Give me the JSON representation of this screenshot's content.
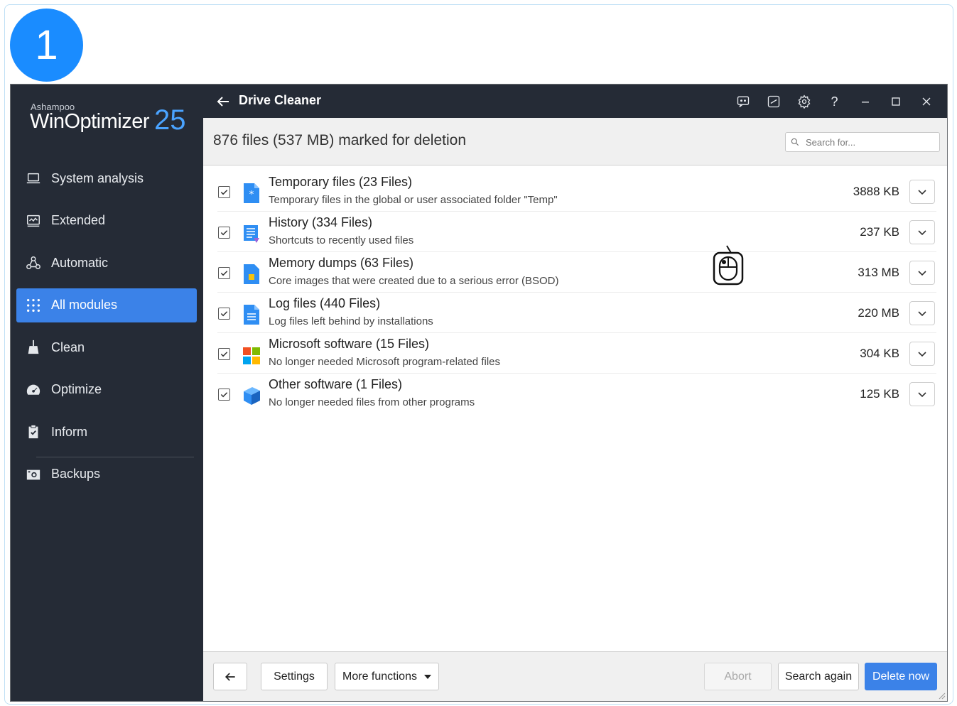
{
  "step_badge": "1",
  "brand": {
    "vendor": "Ashampoo",
    "product": "WinOptimizer",
    "version": "25"
  },
  "sidebar": {
    "items": [
      {
        "label": "System analysis",
        "icon": "laptop-icon",
        "active": false
      },
      {
        "label": "Extended",
        "icon": "monitor-chart-icon",
        "active": false
      },
      {
        "label": "Automatic",
        "icon": "webhook-icon",
        "active": false
      },
      {
        "label": "All modules",
        "icon": "grid-dots-icon",
        "active": true
      },
      {
        "label": "Clean",
        "icon": "broom-icon",
        "active": false
      },
      {
        "label": "Optimize",
        "icon": "speedometer-icon",
        "active": false
      },
      {
        "label": "Inform",
        "icon": "clipboard-check-icon",
        "active": false
      },
      {
        "label": "Backups",
        "icon": "camera-backup-icon",
        "active": false
      }
    ]
  },
  "titlebar": {
    "title": "Drive Cleaner",
    "icons": [
      "chat-icon",
      "note-icon",
      "gear-icon",
      "help-icon",
      "minimize-icon",
      "maximize-icon",
      "close-icon"
    ],
    "help_glyph": "?"
  },
  "summary": {
    "text": "876 files (537 MB) marked for deletion",
    "search_placeholder": "Search for..."
  },
  "items": [
    {
      "title": "Temporary files (23 Files)",
      "desc": "Temporary files in the global or user associated folder \"Temp\"",
      "size": "3888 KB",
      "checked": true,
      "icon": "temp-file-icon"
    },
    {
      "title": "History (334 Files)",
      "desc": "Shortcuts to recently used files",
      "size": "237 KB",
      "checked": true,
      "icon": "history-list-icon"
    },
    {
      "title": "Memory dumps (63 Files)",
      "desc": "Core images that were created due to a serious error (BSOD)",
      "size": "313 MB",
      "checked": true,
      "icon": "memory-dump-icon"
    },
    {
      "title": "Log files (440 Files)",
      "desc": "Log files left behind by installations",
      "size": "220 MB",
      "checked": true,
      "icon": "log-file-icon"
    },
    {
      "title": "Microsoft software (15 Files)",
      "desc": "No longer needed Microsoft program-related files",
      "size": "304 KB",
      "checked": true,
      "icon": "microsoft-logo-icon"
    },
    {
      "title": "Other software (1 Files)",
      "desc": "No longer needed files from other programs",
      "size": "125 KB",
      "checked": true,
      "icon": "software-box-icon"
    }
  ],
  "bottom": {
    "settings_label": "Settings",
    "more_label": "More functions",
    "abort_label": "Abort",
    "search_again_label": "Search again",
    "delete_label": "Delete now"
  },
  "colors": {
    "sidebar": "#252b36",
    "accent": "#3b82e8",
    "badge": "#1a8cff"
  }
}
